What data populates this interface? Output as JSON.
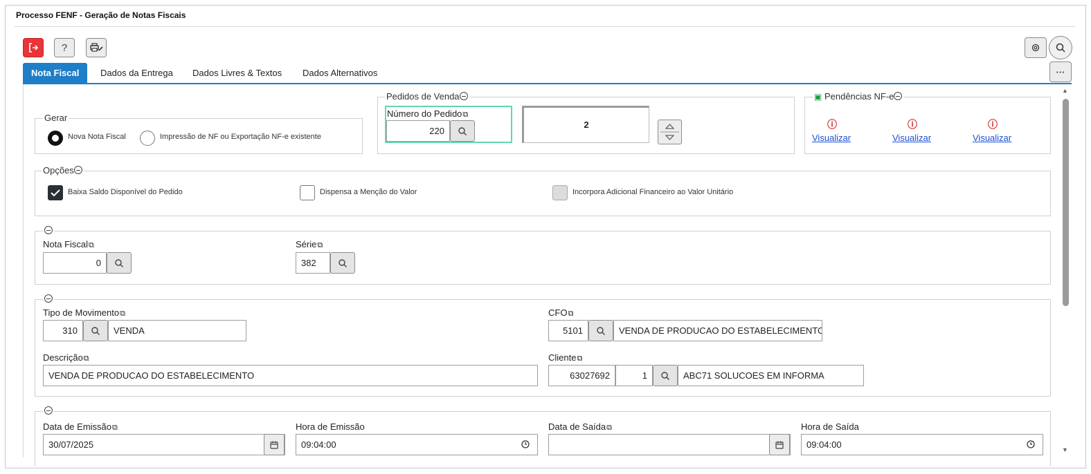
{
  "window": {
    "title": "Processo FENF - Geração de Notas Fiscais"
  },
  "toolbar": {
    "exit_icon": "exit-icon",
    "help_label": "?",
    "print_icon": "printer-edit-icon",
    "settings_icon": "gear-icon",
    "search_icon": "search-icon",
    "more_label": "···"
  },
  "tabs": [
    {
      "label": "Nota Fiscal",
      "active": true
    },
    {
      "label": "Dados da Entrega",
      "active": false
    },
    {
      "label": "Dados Livres & Textos",
      "active": false
    },
    {
      "label": "Dados Alternativos",
      "active": false
    }
  ],
  "gerar": {
    "legend": "Gerar",
    "options": [
      {
        "label": "Nova Nota Fiscal",
        "selected": true
      },
      {
        "label": "Impressão de NF ou Exportação NF-e existente",
        "selected": false
      }
    ]
  },
  "pedidos": {
    "legend": "Pedidos de Venda",
    "numero_label": "Número do Pedido",
    "numero_value": "220",
    "count_value": "2"
  },
  "pendencias": {
    "legend": "Pendências NF-e",
    "links": [
      "Visualizar",
      "Visualizar",
      "Visualizar"
    ]
  },
  "opcoes": {
    "legend": "Opções",
    "items": [
      {
        "label": "Baixa Saldo Disponível do Pedido",
        "checked": true,
        "disabled": false
      },
      {
        "label": "Dispensa a Menção do Valor",
        "checked": false,
        "disabled": false
      },
      {
        "label": "Incorpora Adicional Financeiro ao Valor Unitário",
        "checked": false,
        "disabled": true
      }
    ]
  },
  "nota": {
    "nota_fiscal_label": "Nota Fiscal",
    "nota_fiscal_value": "0",
    "serie_label": "Série",
    "serie_value": "382"
  },
  "movimento": {
    "tipo_label": "Tipo de Movimento",
    "tipo_code": "310",
    "tipo_desc": "VENDA",
    "cfo_label": "CFO",
    "cfo_code": "5101",
    "cfo_desc": "VENDA DE PRODUCAO DO ESTABELECIMENTO",
    "descricao_label": "Descrição",
    "descricao_value": "VENDA DE PRODUCAO DO ESTABELECIMENTO",
    "cliente_label": "Cliente",
    "cliente_code": "63027692",
    "cliente_seq": "1",
    "cliente_name": "ABC71 SOLUCOES EM INFORMA"
  },
  "datas": {
    "emissao_label": "Data de Emissão",
    "emissao_value": "30/07/2025",
    "hora_emissao_label": "Hora de Emissão",
    "hora_emissao_value": "09:04:00",
    "saida_label": "Data de Saída",
    "saida_value": "",
    "hora_saida_label": "Hora de Saída",
    "hora_saida_value": "09:04:00"
  }
}
